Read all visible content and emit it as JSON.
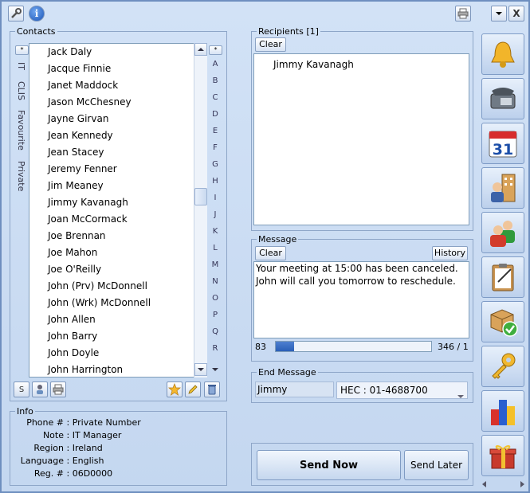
{
  "toolbar": {
    "tools_icon": "wrench-icon",
    "info_icon": "info-icon",
    "print_icon": "printer-icon",
    "dropdown_icon": "chevron-down-icon",
    "close_label": "X"
  },
  "contacts": {
    "legend": "Contacts",
    "tabs": [
      "IT",
      "CLIS",
      "Favourite",
      "Private"
    ],
    "items": [
      "Jack Daly",
      "Jacque Finnie",
      "Janet Maddock",
      "Jason McChesney",
      "Jayne Girvan",
      "Jean Kennedy",
      "Jean Stacey",
      "Jeremy Fenner",
      "Jim Meaney",
      "Jimmy Kavanagh",
      "Joan McCormack",
      "Joe Brennan",
      "Joe Mahon",
      "Joe O'Reilly",
      "John (Prv) McDonnell",
      "John (Wrk) McDonnell",
      "John Allen",
      "John Barry",
      "John Doyle",
      "John Harrington"
    ],
    "letters": [
      "A",
      "B",
      "C",
      "D",
      "E",
      "F",
      "G",
      "H",
      "I",
      "J",
      "K",
      "L",
      "M",
      "N",
      "O",
      "P",
      "Q",
      "R"
    ],
    "s_button": "S"
  },
  "info": {
    "legend": "Info",
    "rows": [
      {
        "key": "Phone #",
        "value": "Private Number"
      },
      {
        "key": "Note",
        "value": "IT Manager"
      },
      {
        "key": "Region",
        "value": "Ireland"
      },
      {
        "key": "Language",
        "value": "English"
      },
      {
        "key": "Reg. #",
        "value": "06D0000"
      }
    ]
  },
  "recipients": {
    "legend": "Recipients [1]",
    "clear": "Clear",
    "items": [
      "Jimmy Kavanagh"
    ]
  },
  "message": {
    "legend": "Message",
    "clear": "Clear",
    "history": "History",
    "text": "Your meeting at 15:00 has been canceled. John will call you tomorrow to reschedule.",
    "char_count": "83",
    "progress": 0.12,
    "parts": "346 / 1"
  },
  "end_message": {
    "legend": "End Message",
    "name": "Jimmy",
    "select_value": "HEC : 01-4688700"
  },
  "send": {
    "now": "Send Now",
    "later": "Send Later"
  },
  "side_icons": [
    "bell-icon",
    "phone-icon",
    "calendar-icon",
    "office-building-icon",
    "users-icon",
    "clipboard-icon",
    "package-check-icon",
    "key-icon",
    "bar-chart-icon",
    "gift-icon"
  ],
  "calendar_day": "31"
}
